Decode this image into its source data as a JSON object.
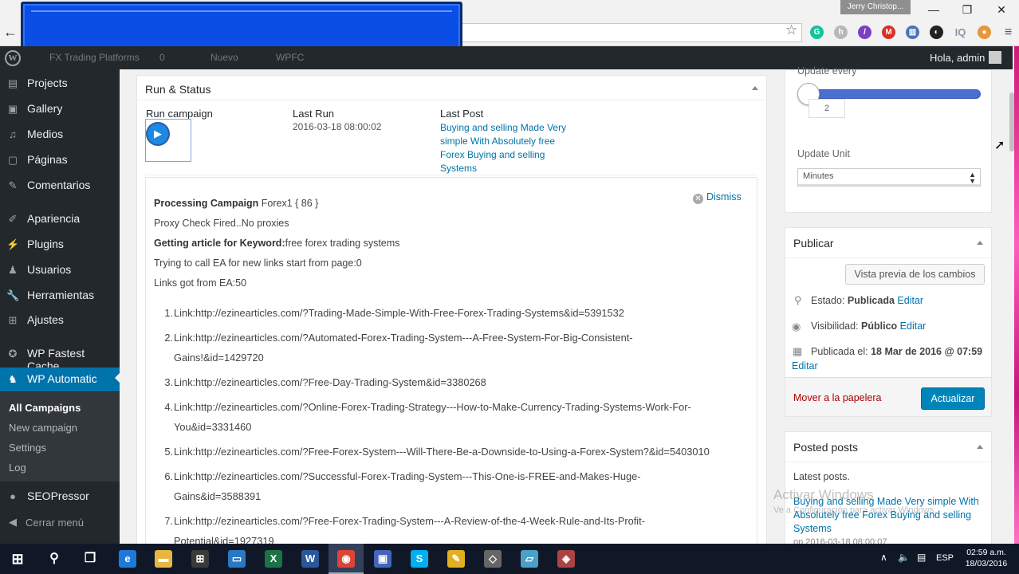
{
  "browser": {
    "profile_name": "Jerry Christop...",
    "controls": {
      "minimize": "—",
      "maximize": "❐",
      "close": "✕"
    },
    "back": "←",
    "bookmark": "☆",
    "extensions": [
      {
        "icon": "grammarly-icon",
        "glyph": "G",
        "color": "#15c39a"
      },
      {
        "icon": "honey-icon",
        "glyph": "h",
        "color": "#b8b8b8"
      },
      {
        "icon": "pen-icon",
        "glyph": "/",
        "color": "#7b3fc4"
      },
      {
        "icon": "gmail-icon",
        "glyph": "M",
        "color": "#d93025"
      },
      {
        "icon": "printer-icon",
        "glyph": "▥",
        "color": "#4a73b5"
      },
      {
        "icon": "circle-icon",
        "glyph": "◐",
        "color": "#222222"
      },
      {
        "icon": "iq-icon",
        "glyph": "IQ",
        "color": "#8899aa"
      },
      {
        "icon": "cookie-icon",
        "glyph": "●",
        "color": "#e8963a"
      },
      {
        "icon": "menu-icon",
        "glyph": "≡",
        "color": "#555555"
      }
    ]
  },
  "adminbar": {
    "logo": "W",
    "site": "FX Trading Platforms",
    "comments": "0",
    "new": "Nuevo",
    "wpfc": "WPFC",
    "howdy": "Hola, admin"
  },
  "sidebar": {
    "items": [
      {
        "label": "Projects",
        "icon": "▤"
      },
      {
        "label": "Gallery",
        "icon": "▣"
      },
      {
        "label": "Medios",
        "icon": "♫"
      },
      {
        "label": "Páginas",
        "icon": "▢"
      },
      {
        "label": "Comentarios",
        "icon": "✎"
      },
      {
        "label": "Apariencia",
        "icon": "✐"
      },
      {
        "label": "Plugins",
        "icon": "⚡"
      },
      {
        "label": "Usuarios",
        "icon": "♟"
      },
      {
        "label": "Herramientas",
        "icon": "🔧"
      },
      {
        "label": "Ajustes",
        "icon": "⊞"
      },
      {
        "label": "WP Fastest Cache",
        "icon": "✪"
      },
      {
        "label": "WP Automatic",
        "icon": "♞"
      }
    ],
    "submenu": [
      "All Campaigns",
      "New campaign",
      "Settings",
      "Log"
    ],
    "seopressor": "SEOPressor",
    "collapse": "Cerrar menú",
    "collapse_icon": "◀"
  },
  "run_status": {
    "title": "Run & Status",
    "run_campaign": "Run campaign",
    "last_run_label": "Last Run",
    "last_run_value": "2016-03-18 08:00:02",
    "last_post_label": "Last Post",
    "last_post_lines": [
      "Buying and selling Made Very",
      "simple With Absolutely free",
      "Forex Buying and selling",
      "Systems"
    ],
    "play": "▶"
  },
  "log": {
    "dismiss": "Dismiss",
    "dismiss_icon": "✕",
    "line1_bold": "Processing Campaign",
    "line1_rest": " Forex1 { 86 }",
    "line2": "Proxy Check Fired..No proxies",
    "line3_bold": "Getting article for Keyword:",
    "line3_rest": "free forex trading systems",
    "line4": "Trying to call EA for new links start from page:0",
    "line5": "Links got from EA:50",
    "links": [
      {
        "num": "1.",
        "lines": [
          "Link:http://ezinearticles.com/?Trading-Made-Simple-With-Free-Forex-Trading-Systems&id=5391532"
        ]
      },
      {
        "num": "2.",
        "lines": [
          "Link:http://ezinearticles.com/?Automated-Forex-Trading-System---A-Free-System-For-Big-Consistent-",
          "Gains!&id=1429720"
        ]
      },
      {
        "num": "3.",
        "lines": [
          "Link:http://ezinearticles.com/?Free-Day-Trading-System&id=3380268"
        ]
      },
      {
        "num": "4.",
        "lines": [
          "Link:http://ezinearticles.com/?Online-Forex-Trading-Strategy---How-to-Make-Currency-Trading-Systems-Work-For-",
          "You&id=3331460"
        ]
      },
      {
        "num": "5.",
        "lines": [
          "Link:http://ezinearticles.com/?Free-Forex-System---Will-There-Be-a-Downside-to-Using-a-Forex-System?&id=5403010"
        ]
      },
      {
        "num": "6.",
        "lines": [
          "Link:http://ezinearticles.com/?Successful-Forex-Trading-System---This-One-is-FREE-and-Makes-Huge-",
          "Gains&id=3588391"
        ]
      },
      {
        "num": "7.",
        "lines": [
          "Link:http://ezinearticles.com/?Free-Forex-Trading-System---A-Review-of-the-4-Week-Rule-and-Its-Profit-",
          "Potential&id=1927319"
        ]
      }
    ]
  },
  "schedule": {
    "update_every_label": "Update every",
    "update_every_value": "2",
    "update_every_fraction": 0.0,
    "update_unit_label": "Update Unit",
    "update_unit_value": "Minutes",
    "select_caret": "▲▼"
  },
  "publish": {
    "title": "Publicar",
    "preview": "Vista previa de los cambios",
    "status_label": "Estado: ",
    "status_value": "Publicada",
    "visibility_label": "Visibilidad: ",
    "visibility_value": "Público",
    "published_label": "Publicada el: ",
    "published_value": "18 Mar de 2016 @ 07:59",
    "edit": "Editar",
    "trash": "Mover a la papelera",
    "update": "Actualizar",
    "pin_icon": "⚲",
    "eye_icon": "◉",
    "calendar_icon": "▦"
  },
  "posted": {
    "title": "Posted posts",
    "latest": "Latest posts.",
    "post_lines": [
      "Buying and selling Made Very simple With",
      "Absolutely free Forex Buying and selling",
      "Systems"
    ],
    "post_date": "on 2016-03-18 08:00:07"
  },
  "watermark": {
    "line1": "Activar Windows",
    "line2": "Ve a Configuración para activar Windows."
  },
  "taskbar": {
    "start": "⊞",
    "search": "⚲",
    "taskview": "❐",
    "apps": [
      {
        "icon": "edge-icon",
        "glyph": "e",
        "color": "#1e7ad9"
      },
      {
        "icon": "explorer-icon",
        "glyph": "▬",
        "color": "#e8b640"
      },
      {
        "icon": "store-icon",
        "glyph": "⊞",
        "color": "#3a3a3a"
      },
      {
        "icon": "monitor-icon",
        "glyph": "▭",
        "color": "#2a78c2"
      },
      {
        "icon": "excel-icon",
        "glyph": "X",
        "color": "#1e7145"
      },
      {
        "icon": "word-icon",
        "glyph": "W",
        "color": "#2b579a"
      },
      {
        "icon": "chrome-icon",
        "glyph": "◉",
        "color": "#db4437"
      },
      {
        "icon": "remote-icon",
        "glyph": "▣",
        "color": "#4466bb"
      },
      {
        "icon": "skype-icon",
        "glyph": "S",
        "color": "#00aff0"
      },
      {
        "icon": "pencil-icon",
        "glyph": "✎",
        "color": "#e0b020"
      },
      {
        "icon": "box-icon",
        "glyph": "◇",
        "color": "#666666"
      },
      {
        "icon": "tablet-icon",
        "glyph": "▱",
        "color": "#4aa0c8"
      },
      {
        "icon": "tool-icon",
        "glyph": "◈",
        "color": "#aa4444"
      }
    ],
    "tray_up": "∧",
    "tray_sound": "🔈",
    "tray_msg": "▤",
    "lang": "ESP",
    "time": "02:59 a.m.",
    "date": "18/03/2016"
  }
}
